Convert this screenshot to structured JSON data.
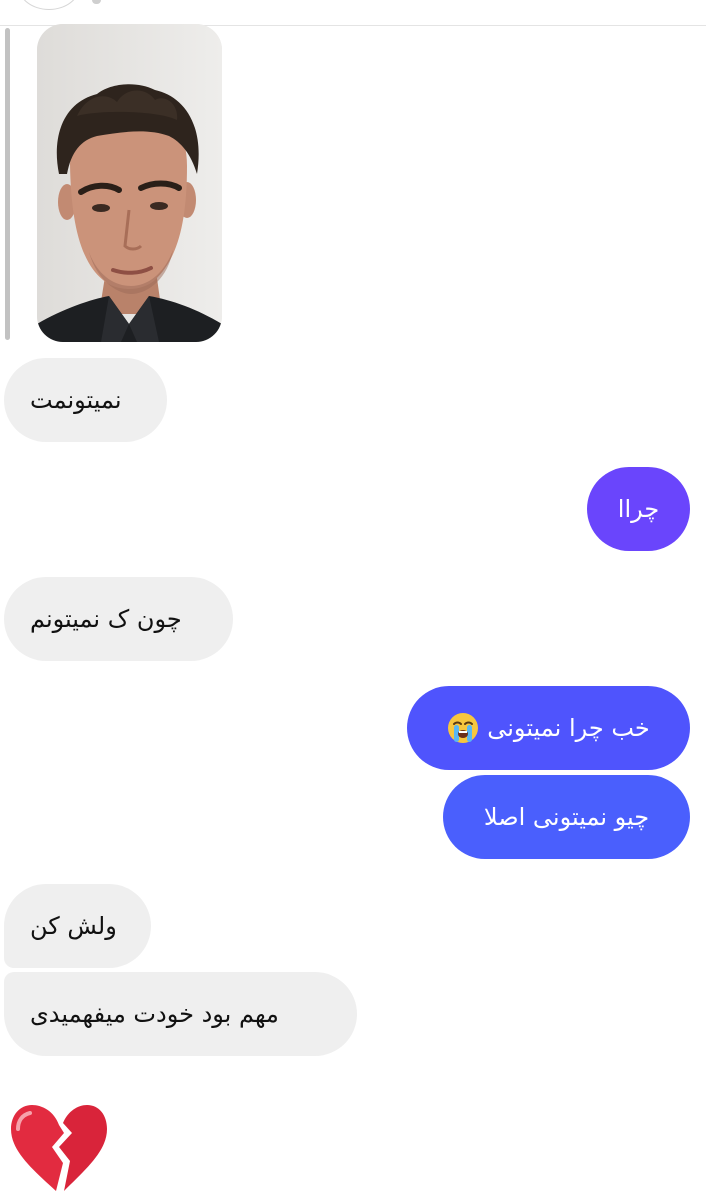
{
  "messages": [
    {
      "id": "m1",
      "side": "received",
      "text": "نمیتونمت"
    },
    {
      "id": "m2",
      "side": "sent",
      "text": "چراا"
    },
    {
      "id": "m3",
      "side": "received",
      "text": "چون ک نمیتونم"
    },
    {
      "id": "m4",
      "side": "sent",
      "text": "خب چرا نمیتونی",
      "emoji": "loudly-crying-face-emoji"
    },
    {
      "id": "m5",
      "side": "sent",
      "text": "چیو نمیتونی اصلا"
    },
    {
      "id": "m6",
      "side": "received",
      "text": "ولش کن"
    },
    {
      "id": "m7",
      "side": "received",
      "text": "مهم بود خودت میفهمیدی"
    }
  ],
  "reaction": {
    "icon": "broken-heart-emoji"
  },
  "colors": {
    "received_bubble": "#efefef",
    "sent_bubble_top": "#6a45fc",
    "sent_bubble_mid": "#4f54fd",
    "sent_bubble_bottom": "#4a5ffd",
    "reply_bar": "#c2c2c2"
  }
}
